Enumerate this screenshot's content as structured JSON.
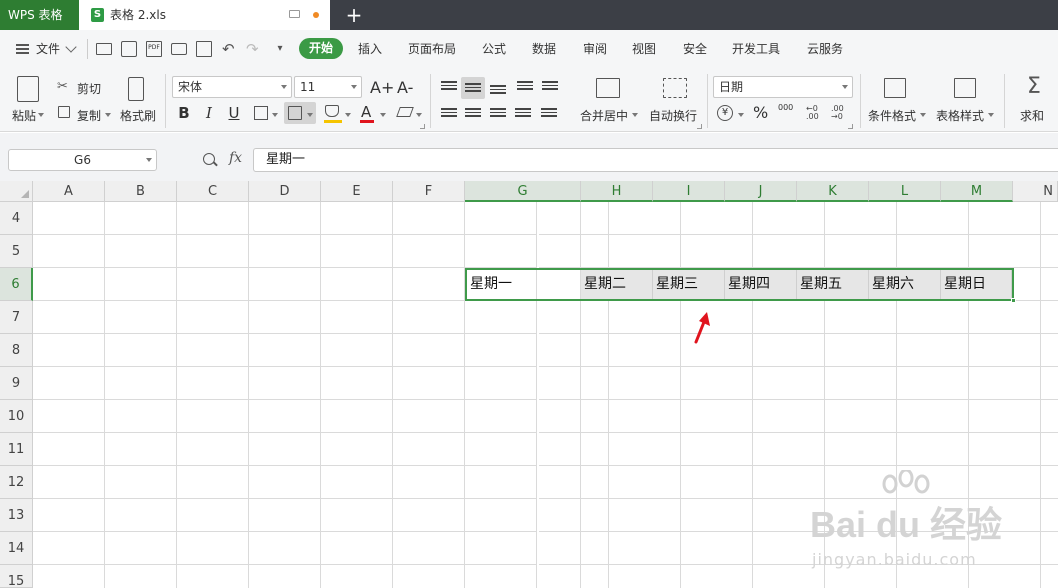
{
  "app_title": "WPS 表格",
  "document_tab": {
    "icon_letter": "S",
    "name": "表格 2.xls"
  },
  "menu": {
    "file_label": "文件",
    "items": [
      "开始",
      "插入",
      "页面布局",
      "公式",
      "数据",
      "审阅",
      "视图",
      "安全",
      "开发工具",
      "云服务"
    ],
    "active_index": 0
  },
  "ribbon": {
    "paste": "粘贴",
    "cut": "剪切",
    "copy": "复制",
    "format_painter": "格式刷",
    "font_name": "宋体",
    "font_size": "11",
    "bold": "B",
    "italic": "I",
    "underline": "U",
    "merge_center": "合并居中",
    "wrap_text": "自动换行",
    "number_format": "日期",
    "percent": "%",
    "thousands": "000",
    "cond_format": "条件格式",
    "table_style": "表格样式",
    "sum": "求和",
    "increase_font": "A+",
    "decrease_font": "A-",
    "font_color_letter": "A",
    "currency": "¥"
  },
  "formula_bar": {
    "name_box": "G6",
    "fx": "fx",
    "value": "星期一"
  },
  "grid": {
    "columns": [
      "A",
      "B",
      "C",
      "D",
      "E",
      "F",
      "G",
      "H",
      "I",
      "J",
      "K",
      "L",
      "M",
      "N"
    ],
    "selected_columns": [
      "G",
      "H",
      "I",
      "J",
      "K",
      "L",
      "M"
    ],
    "rows": [
      "4",
      "5",
      "6",
      "7",
      "8",
      "9",
      "10",
      "11",
      "12",
      "13",
      "14",
      "15"
    ],
    "selected_row": "6",
    "row6_cells": [
      "星期一",
      "星期二",
      "星期三",
      "星期四",
      "星期五",
      "星期六",
      "星期日"
    ]
  },
  "colors": {
    "accent": "#3b9a45",
    "app_tab": "#2e7d32",
    "title_bar": "#3c3f46",
    "annotation_arrow": "#e0141e"
  },
  "watermark": {
    "brand": "Bai du 经验",
    "url": "jingyan.baidu.com"
  }
}
